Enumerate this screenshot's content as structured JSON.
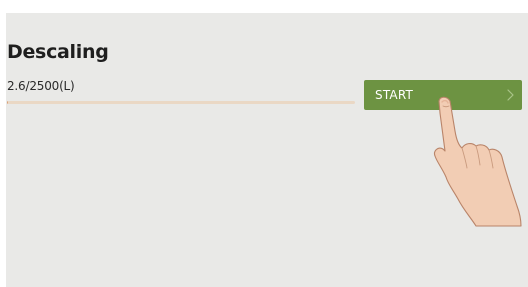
{
  "section": {
    "title": "Descaling",
    "progress_text": "2.6/2500(L)",
    "progress_fraction": 0.00104
  },
  "start_button": {
    "label": "START",
    "icon": "chevron-right-icon"
  },
  "pointer": {
    "icon": "hand-cursor-icon"
  },
  "colors": {
    "panel_background": "#e9e9e7",
    "button_green": "#6d9342",
    "progress_track": "#ead8c5",
    "progress_fill": "#d9a27a",
    "title_text": "#1e1e1e"
  }
}
